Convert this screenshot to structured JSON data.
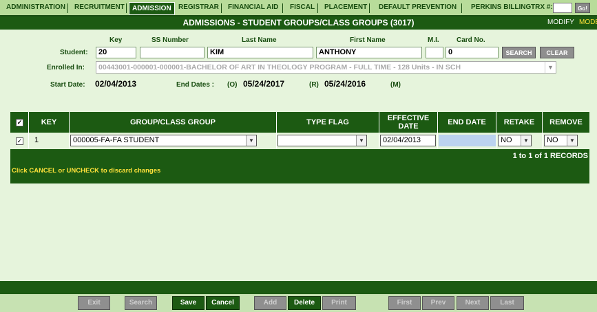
{
  "nav": {
    "tabs": [
      "ADMINISTRATION",
      "RECRUITMENT",
      "ADMISSION",
      "REGISTRAR",
      "FINANCIAL AID",
      "FISCAL",
      "PLACEMENT",
      "DEFAULT PREVENTION",
      "PERKINS BILLING"
    ],
    "active_tab": "ADMISSION",
    "trx_label": "TRX #:",
    "trx_value": "",
    "go_label": "Go!"
  },
  "header": {
    "title": "ADMISSIONS - STUDENT GROUPS/CLASS GROUPS (3017)",
    "modify_label": "MODIFY",
    "mode_label": "MODE"
  },
  "student": {
    "label": "Student:",
    "key_label": "Key",
    "ssn_label": "SS Number",
    "last_label": "Last Name",
    "first_label": "First Name",
    "mi_label": "M.I.",
    "card_label": "Card No.",
    "key": "20",
    "ssn": "",
    "last_name": "KIM",
    "first_name": "ANTHONY",
    "mi": "",
    "card_no": "0",
    "search_label": "SEARCH",
    "clear_label": "CLEAR"
  },
  "enrollment": {
    "label": "Enrolled In:",
    "value": "00443001-000001-000001-BACHELOR OF ART IN THEOLOGY PROGRAM - FULL TIME - 128 Units - IN SCH"
  },
  "dates": {
    "start_label": "Start Date:",
    "start": "02/04/2013",
    "end_label": "End Dates :",
    "o_label": "(O)",
    "o_date": "05/24/2017",
    "r_label": "(R)",
    "r_date": "05/24/2016",
    "m_label": "(M)"
  },
  "grid": {
    "headers": {
      "key": "KEY",
      "group": "GROUP/CLASS GROUP",
      "type": "TYPE FLAG",
      "effective_1": "EFFECTIVE",
      "effective_2": "DATE",
      "end": "END DATE",
      "retake": "RETAKE",
      "remove": "REMOVE"
    },
    "rows": [
      {
        "checked": true,
        "key": "1",
        "group": "000005-FA-FA STUDENT",
        "type_flag": "",
        "effective_date": "02/04/2013",
        "end_date": "",
        "retake": "NO",
        "remove": "NO"
      }
    ],
    "records": "1 to 1 of 1 RECORDS",
    "message": "Click CANCEL or UNCHECK to discard changes"
  },
  "footer": {
    "exit": "Exit",
    "search": "Search",
    "save": "Save",
    "cancel": "Cancel",
    "add": "Add",
    "delete": "Delete",
    "print": "Print",
    "first": "First",
    "prev": "Prev",
    "next": "Next",
    "last": "Last"
  },
  "colors": {
    "primary_green": "#1c5a12",
    "page_bg": "#e6f4dc",
    "accent_yellow": "#ffe23a",
    "end_date_fill": "#bcd3ef"
  }
}
